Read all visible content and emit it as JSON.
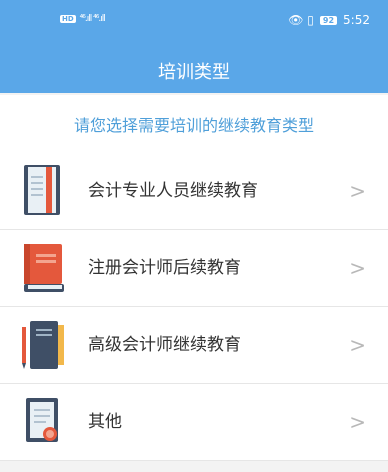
{
  "status_bar": {
    "hd": "HD",
    "signal": "⁴⁶.ıll ⁴⁶.ıll",
    "icons": "👁 ▯",
    "battery": "92",
    "time": "5:52"
  },
  "nav": {
    "title": "培训类型"
  },
  "subheader": {
    "text": "请您选择需要培训的继续教育类型"
  },
  "list": {
    "items": [
      {
        "label": "会计专业人员继续教育",
        "icon": "notebook-icon",
        "chevron": ">"
      },
      {
        "label": "注册会计师后续教育",
        "icon": "book-icon",
        "chevron": ">"
      },
      {
        "label": "高级会计师继续教育",
        "icon": "notebook-pen-icon",
        "chevron": ">"
      },
      {
        "label": "其他",
        "icon": "certificate-icon",
        "chevron": ">"
      }
    ]
  },
  "colors": {
    "accent": "#5aa7e8",
    "subheader_text": "#4f9fd9"
  }
}
